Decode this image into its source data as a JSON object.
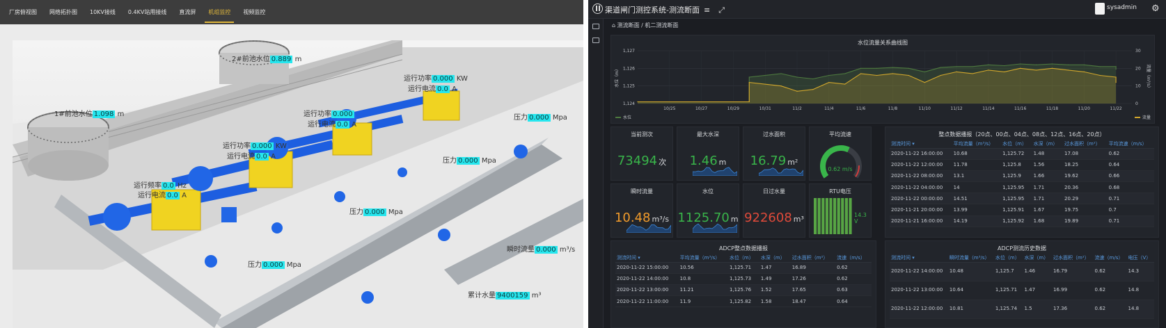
{
  "left": {
    "nav": [
      "厂房俯视图",
      "网络拓扑图",
      "10KV接线",
      "0.4KV站用接线",
      "直流屏",
      "机组监控",
      "视频监控"
    ],
    "active_tab_index": 5,
    "labels": {
      "tank1": {
        "prefix": "1#前池水位",
        "value": "1.098",
        "unit": "m"
      },
      "tank2": {
        "prefix": "2#前池水位",
        "value": "0.889",
        "unit": "m"
      },
      "u1_freq": {
        "prefix": "运行频率",
        "value": "0.0",
        "unit": "Hz"
      },
      "u1_current": {
        "prefix": "运行电流",
        "value": "0.0",
        "unit": "A"
      },
      "u2_power": {
        "prefix": "运行功率",
        "value": "0.000",
        "unit": "KW"
      },
      "u2_current": {
        "prefix": "运行电流",
        "value": "0.0",
        "unit": "A"
      },
      "u3_power": {
        "prefix": "运行功率",
        "value": "0.000",
        "unit": ""
      },
      "u3_current": {
        "prefix": "运行电流",
        "value": "0.0",
        "unit": "A"
      },
      "u4_power": {
        "prefix": "运行功率",
        "value": "0.000",
        "unit": "KW"
      },
      "u4_current": {
        "prefix": "运行电流",
        "value": "0.0",
        "unit": "A"
      },
      "p1": {
        "prefix": "压力",
        "value": "0.000",
        "unit": "Mpa"
      },
      "p2": {
        "prefix": "压力",
        "value": "0.000",
        "unit": "Mpa"
      },
      "p3": {
        "prefix": "压力",
        "value": "0.000",
        "unit": "Mpa"
      },
      "p4": {
        "prefix": "压力",
        "value": "0.000",
        "unit": "Mpa"
      },
      "flow": {
        "prefix": "瞬时流量",
        "value": "0.000",
        "unit": "m³/s"
      },
      "total": {
        "prefix": "累计水量",
        "value": "9400159",
        "unit": "m³"
      }
    }
  },
  "right": {
    "title": "渠道闸门测控系统-测流断面",
    "menu_icon": "hamburger-icon",
    "expand_icon": "expand-icon",
    "user": "sysadmin",
    "breadcrumb": {
      "home": "测流断面",
      "sep": "/",
      "current": "机二测流断面"
    },
    "chart_data": {
      "type": "line",
      "title": "水位流量关系曲线图",
      "ylabel": "水位（m）",
      "y2label": "流量（m³/s）",
      "ylim": [
        1124,
        1127
      ],
      "y2lim": [
        0,
        30
      ],
      "yticks": [
        1124,
        1125,
        1126,
        1127
      ],
      "y2ticks": [
        0,
        10,
        20,
        30
      ],
      "categories": [
        "10/25",
        "10/27",
        "10/29",
        "10/31",
        "11/2",
        "11/4",
        "11/6",
        "11/8",
        "11/10",
        "11/12",
        "11/14",
        "11/16",
        "11/18",
        "11/20",
        "11/22"
      ],
      "x_domain": [
        "10/23",
        "11/23"
      ],
      "legend": {
        "left": "水位",
        "right": "流量"
      },
      "series": [
        {
          "name": "水位",
          "axis": "left",
          "color": "#4e7a3f",
          "x": [
            "10/23",
            "10/30",
            "10/30",
            "11/1",
            "11/2",
            "11/3",
            "11/4",
            "11/5",
            "11/6",
            "11/7",
            "11/8",
            "11/9",
            "11/10",
            "11/11",
            "11/12",
            "11/13",
            "11/14",
            "11/15",
            "11/16",
            "11/17",
            "11/18",
            "11/19",
            "11/20",
            "11/21",
            "11/22",
            "11/22"
          ],
          "y": [
            1124.1,
            1124.1,
            1125.5,
            1125.7,
            1125.5,
            1125.4,
            1125.6,
            1125.7,
            1126.0,
            1126.0,
            1126.05,
            1126.0,
            1125.8,
            1126.05,
            1126.1,
            1126.1,
            1126.2,
            1126.15,
            1126.25,
            1126.2,
            1126.25,
            1126.2,
            1126.2,
            1126.1,
            1126.1,
            1125.95
          ]
        },
        {
          "name": "流量",
          "axis": "right",
          "color": "#d3a82c",
          "x": [
            "10/23",
            "10/30",
            "10/30",
            "11/1",
            "11/2",
            "11/3",
            "11/4",
            "11/5",
            "11/6",
            "11/7",
            "11/8",
            "11/9",
            "11/10",
            "11/11",
            "11/12",
            "11/13",
            "11/14",
            "11/15",
            "11/16",
            "11/17",
            "11/18",
            "11/19",
            "11/20",
            "11/21",
            "11/22",
            "11/22"
          ],
          "y": [
            1,
            1,
            12,
            10,
            7,
            8,
            12,
            11,
            17,
            16,
            17,
            16,
            12,
            16,
            18,
            17,
            19,
            18,
            20,
            19,
            20,
            19,
            18,
            16,
            15,
            12
          ]
        }
      ]
    },
    "cards": [
      {
        "title": "当前测次",
        "value": "73494",
        "unit": "次",
        "color": "#39b54a"
      },
      {
        "title": "最大水深",
        "value": "1.46",
        "unit": "m",
        "color": "#39b54a"
      },
      {
        "title": "过水面积",
        "value": "16.79",
        "unit": "m²",
        "color": "#39b54a"
      },
      {
        "title": "平均流速",
        "value": "0.62",
        "unit": "m/s",
        "gauge": true,
        "gauge_fraction": 0.6,
        "color": "#39b54a"
      },
      {
        "title": "瞬时流量",
        "value": "10.48",
        "unit": "m³/s",
        "color": "#f39c2b"
      },
      {
        "title": "水位",
        "value": "1125.70",
        "unit": "m",
        "color": "#39b54a"
      },
      {
        "title": "日过水量",
        "value": "922608",
        "unit": "m³",
        "color": "#e04a3a"
      },
      {
        "title": "RTU电压",
        "value": "14.3",
        "unit": "V",
        "bars": true,
        "bar_count": 10,
        "color": "#39b54a"
      }
    ],
    "table1": {
      "title": "整点数据播报（20点、00点、04点、08点、12点、16点、20点）",
      "headers": [
        "测流时间",
        "平均流量（m³/s）",
        "水位（m）",
        "水深（m）",
        "过水面积（m²）",
        "平均流速（m/s）"
      ],
      "rows": [
        [
          "2020-11-22 16:00:00",
          "10.68",
          "1,125.72",
          "1.48",
          "17.08",
          "0.62"
        ],
        [
          "2020-11-22 12:00:00",
          "11.78",
          "1,125.8",
          "1.56",
          "18.25",
          "0.64"
        ],
        [
          "2020-11-22 08:00:00",
          "13.1",
          "1,125.9",
          "1.66",
          "19.62",
          "0.66"
        ],
        [
          "2020-11-22 04:00:00",
          "14",
          "1,125.95",
          "1.71",
          "20.36",
          "0.68"
        ],
        [
          "2020-11-22 00:00:00",
          "14.51",
          "1,125.95",
          "1.71",
          "20.29",
          "0.71"
        ],
        [
          "2020-11-21 20:00:00",
          "13.99",
          "1,125.91",
          "1.67",
          "19.75",
          "0.7"
        ],
        [
          "2020-11-21 16:00:00",
          "14.19",
          "1,125.92",
          "1.68",
          "19.89",
          "0.71"
        ]
      ]
    },
    "table2": {
      "title": "ADCP整点数据播报",
      "headers": [
        "测流时间",
        "平均流量（m³/s）",
        "水位（m）",
        "水深（m）",
        "过水面积（m²）",
        "流速（m/s）"
      ],
      "rows": [
        [
          "2020-11-22 15:00:00",
          "10.56",
          "1,125.71",
          "1.47",
          "16.89",
          "0.62"
        ],
        [
          "2020-11-22 14:00:00",
          "10.8",
          "1,125.73",
          "1.49",
          "17.26",
          "0.62"
        ],
        [
          "2020-11-22 13:00:00",
          "11.21",
          "1,125.76",
          "1.52",
          "17.65",
          "0.63"
        ],
        [
          "2020-11-22 11:00:00",
          "11.9",
          "1,125.82",
          "1.58",
          "18.47",
          "0.64"
        ]
      ]
    },
    "table3": {
      "title": "ADCP测流历史数据",
      "headers": [
        "测流时间",
        "瞬时流量（m³/s）",
        "水位（m）",
        "水深（m）",
        "过水面积（m²）",
        "流速（m/s）",
        "电压（V）"
      ],
      "rows": [
        [
          "2020-11-22 14:00:00",
          "10.48",
          "1,125.7",
          "1.46",
          "16.79",
          "0.62",
          "14.3"
        ],
        [
          "2020-11-22 13:00:00",
          "10.64",
          "1,125.71",
          "1.47",
          "16.99",
          "0.62",
          "14.8"
        ],
        [
          "2020-11-22 12:00:00",
          "10.81",
          "1,125.74",
          "1.5",
          "17.36",
          "0.62",
          "14.8"
        ]
      ]
    }
  }
}
